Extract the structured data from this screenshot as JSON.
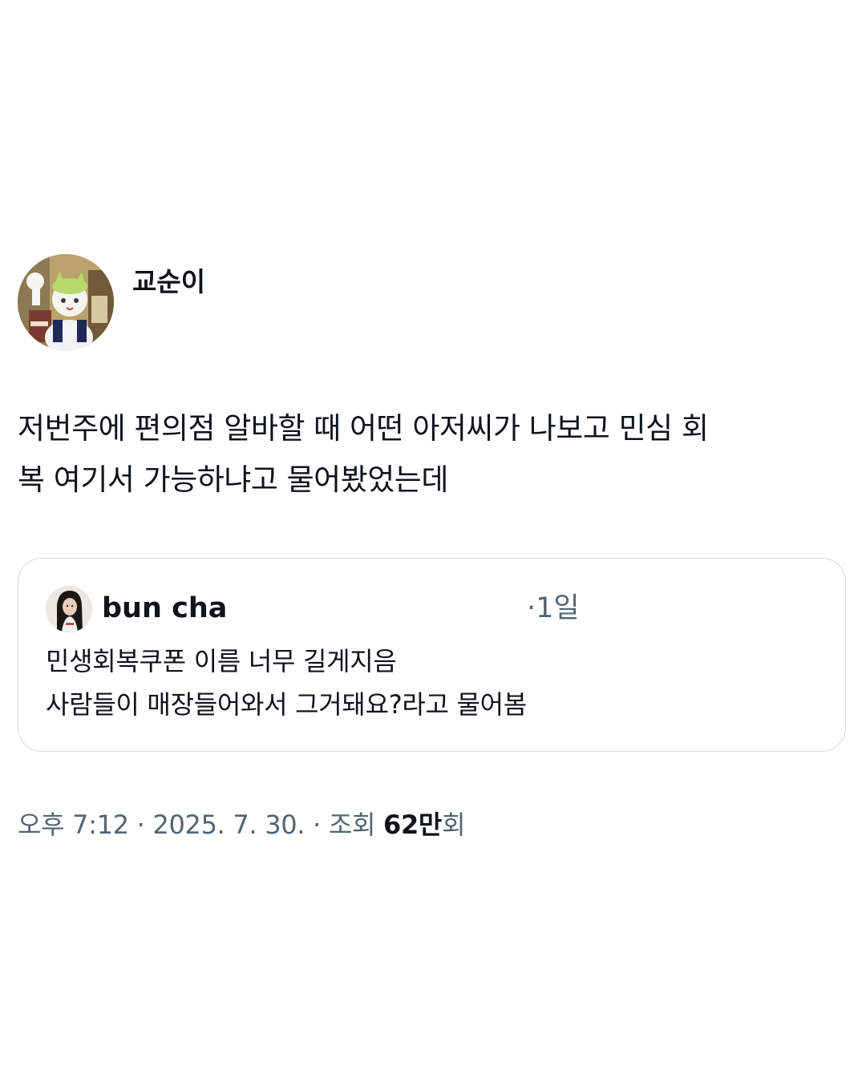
{
  "author": {
    "display_name": "교순이",
    "avatar_icon": "character-avatar-icon"
  },
  "tweet": {
    "text_lines": [
      "저번주에 편의점 알바할 때 어떤 아저씨가 나보고 민심 회",
      "복 여기서 가능하냐고 물어봤었는데"
    ]
  },
  "quote": {
    "display_name": "bun cha",
    "time": "·1일",
    "avatar_icon": "profile-photo-icon",
    "text_lines": [
      "민생회복쿠폰 이름 너무 길게지음",
      "사람들이 매장들어와서 그거돼요?라고 물어봄"
    ]
  },
  "meta": {
    "time": "오후 7:12",
    "separator": " · ",
    "date": "2025. 7. 30.",
    "views_label": "조회 ",
    "views_count": "62만",
    "views_suffix": "회"
  },
  "colors": {
    "text_primary": "#0f1419",
    "text_secondary": "#536471",
    "border": "#cfd9de",
    "background": "#ffffff"
  }
}
